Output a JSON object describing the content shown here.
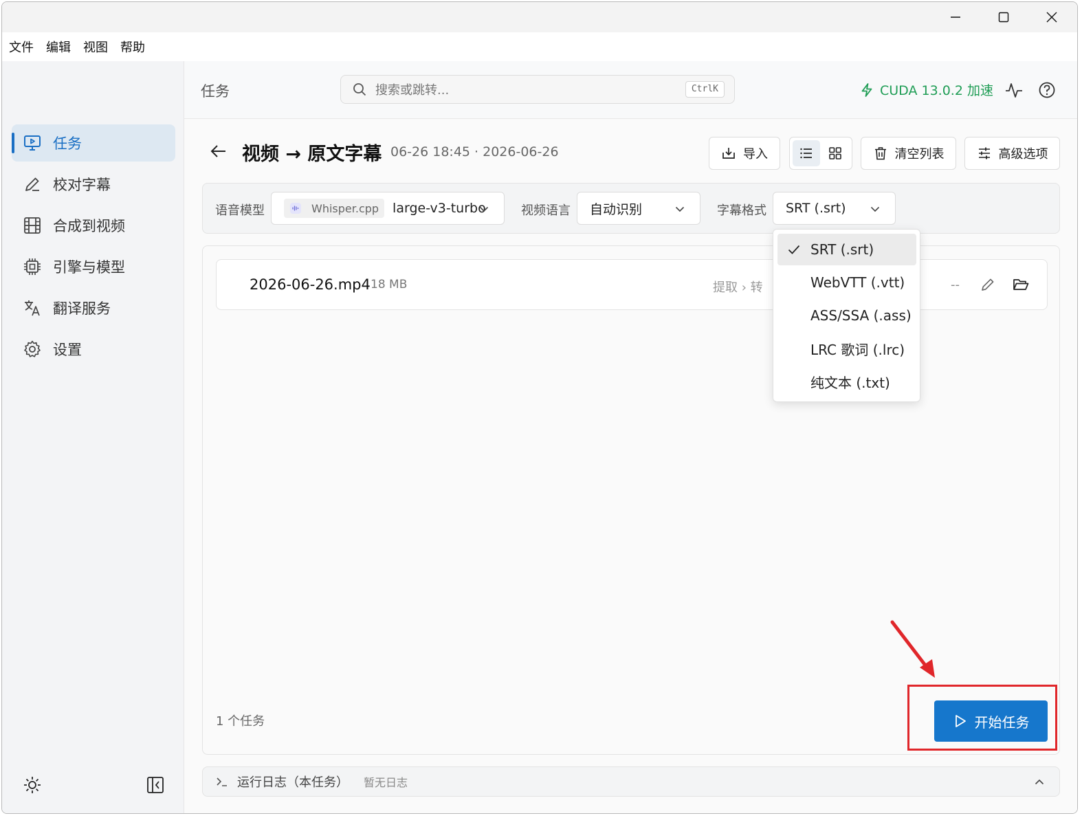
{
  "window": {
    "controls": {
      "minimize": "minimize-icon",
      "maximize": "maximize-icon",
      "close": "close-icon"
    }
  },
  "menubar": {
    "items": [
      "文件",
      "编辑",
      "视图",
      "帮助"
    ]
  },
  "sidebar": {
    "items": [
      {
        "label": "任务",
        "icon": "monitor-play-icon",
        "active": true
      },
      {
        "label": "校对字幕",
        "icon": "pen-icon"
      },
      {
        "label": "合成到视频",
        "icon": "film-icon"
      },
      {
        "label": "引擎与模型",
        "icon": "cpu-icon"
      },
      {
        "label": "翻译服务",
        "icon": "translate-icon"
      },
      {
        "label": "设置",
        "icon": "gear-icon"
      }
    ],
    "bottom": {
      "theme": "sun-icon",
      "collapse": "collapse-sidebar-icon"
    }
  },
  "topbar": {
    "breadcrumb": "任务",
    "search_placeholder": "搜索或跳转...",
    "shortcut": "CtrlK",
    "cuda": "CUDA 13.0.2 加速",
    "cuda_color": "#1f9d55",
    "icons": [
      "activity-icon",
      "help-icon"
    ]
  },
  "page": {
    "title": "视频 → 原文字幕",
    "subtitle": "06-26 18:45 · 2026-06-26",
    "buttons": {
      "import": "导入",
      "clear": "清空列表",
      "advanced": "高级选项"
    },
    "view_mode": "list"
  },
  "options": {
    "model_label": "语音模型",
    "engine": "Whisper.cpp",
    "model": "large-v3-turbo",
    "language_label": "视频语言",
    "language": "自动识别",
    "format_label": "字幕格式",
    "format": "SRT (.srt)"
  },
  "format_menu": {
    "items": [
      "SRT (.srt)",
      "WebVTT (.vtt)",
      "ASS/SSA (.ass)",
      "LRC 歌词 (.lrc)",
      "纯文本 (.txt)"
    ],
    "selected": 0
  },
  "tasks": {
    "items": [
      {
        "file": "2026-06-26.mp4",
        "size": "18 MB",
        "steps": "提取  ›  转",
        "status": "--"
      }
    ],
    "count_text": "1 个任务",
    "start_label": "开始任务",
    "accent": "#1677cc"
  },
  "log": {
    "title": "运行日志（本任务）",
    "empty": "暂无日志"
  },
  "annotation": {
    "color": "#e0262a"
  }
}
